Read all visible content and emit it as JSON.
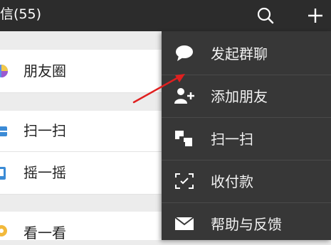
{
  "header": {
    "title": "信(55)",
    "search_icon": "search-icon",
    "add_icon": "plus-icon"
  },
  "discover": {
    "items": [
      {
        "label": "朋友圈",
        "icon": "moments-icon"
      },
      {
        "label": "扫一扫",
        "icon": "scan-icon"
      },
      {
        "label": "摇一摇",
        "icon": "shake-icon"
      },
      {
        "label": "看一看",
        "icon": "top-stories-icon"
      }
    ]
  },
  "popup_menu": {
    "items": [
      {
        "label": "发起群聊",
        "icon": "chat-bubble-icon"
      },
      {
        "label": "添加朋友",
        "icon": "add-friend-icon"
      },
      {
        "label": "扫一扫",
        "icon": "scan-icon"
      },
      {
        "label": "收付款",
        "icon": "money-icon"
      },
      {
        "label": "帮助与反馈",
        "icon": "mail-icon"
      }
    ]
  },
  "colors": {
    "header_bg": "#2c2c2c",
    "menu_bg": "#373737",
    "annotation_arrow": "#e02020"
  }
}
